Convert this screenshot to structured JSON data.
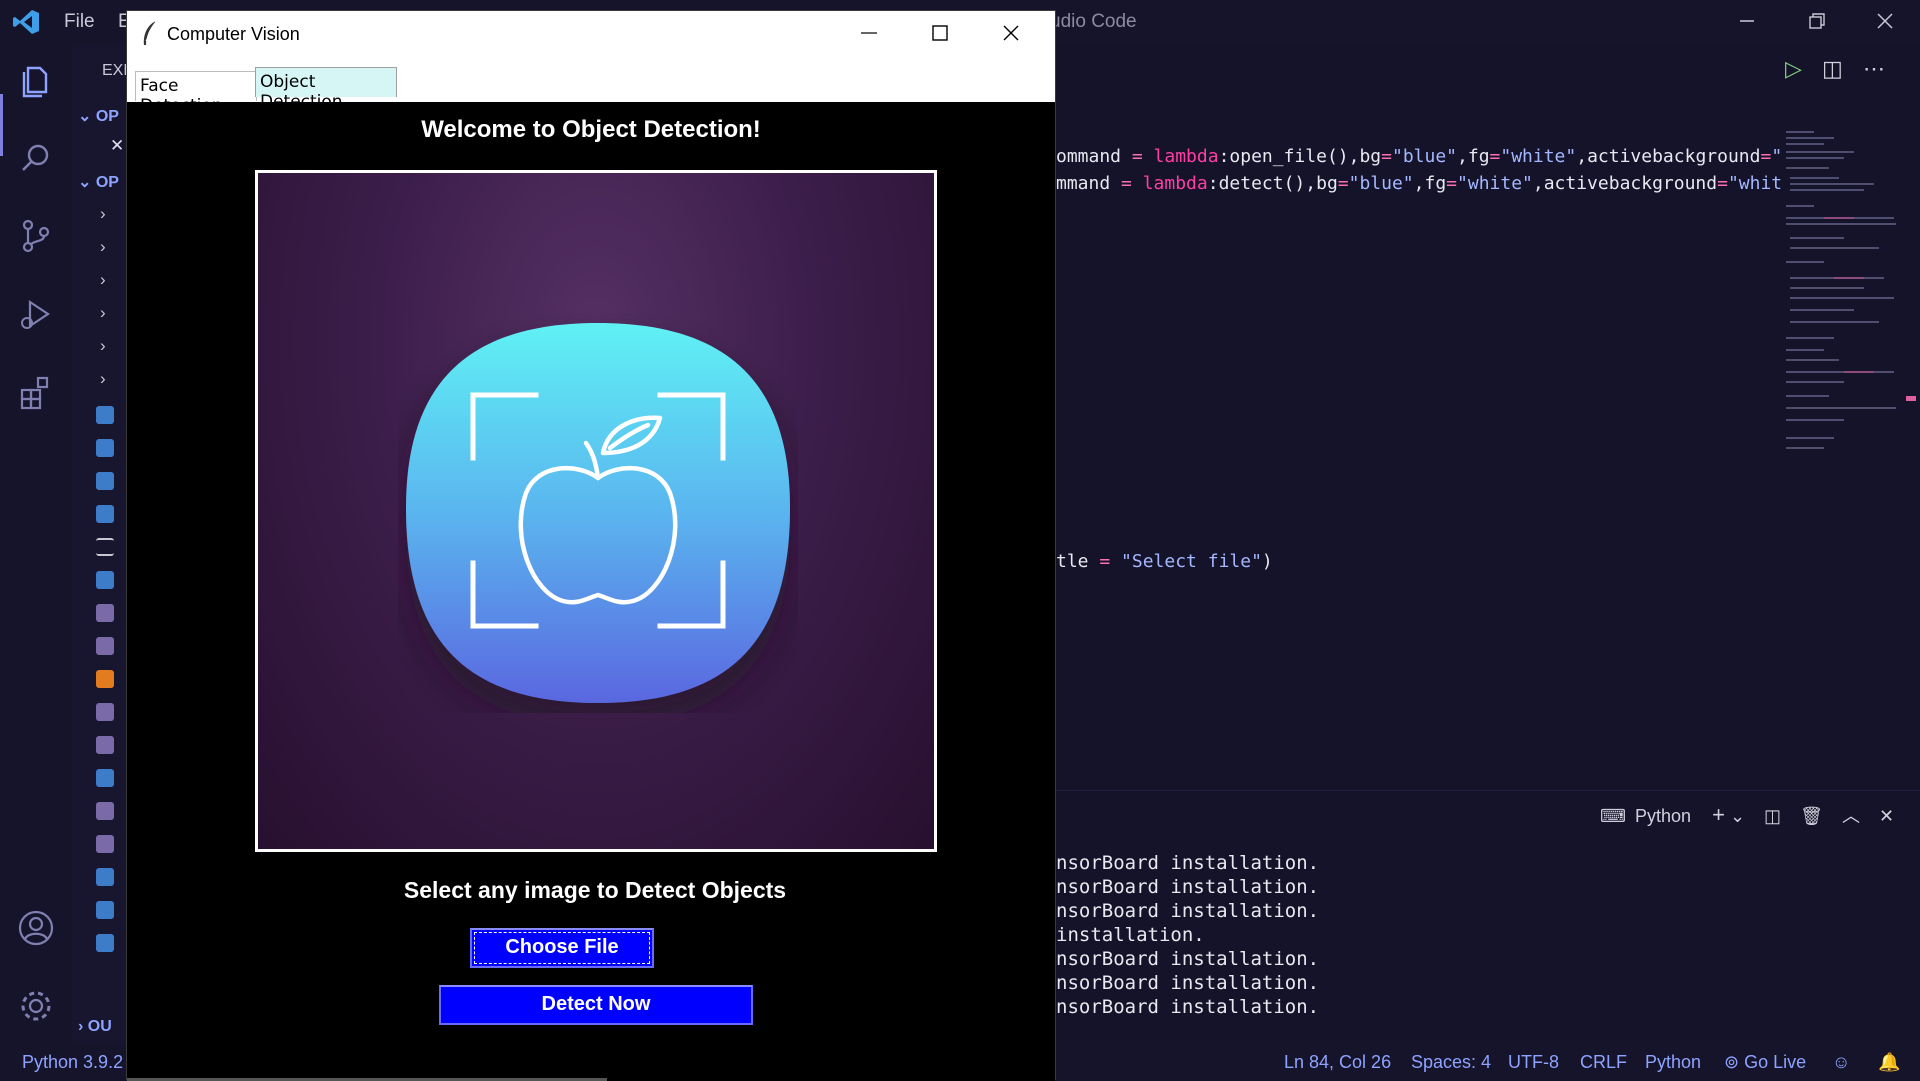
{
  "vscode": {
    "menu": {
      "file": "File",
      "edit": "E"
    },
    "title_fragment": "udio Code",
    "sidebar": {
      "explorer_label": "EXP",
      "open_editors_section": "OP",
      "open_folder_section": "OP",
      "outline_section": "OU",
      "close_glyph": "✕"
    },
    "code_lines": [
      {
        "a": "ommand",
        "b": " = ",
        "c": "lambda",
        "d": ":open_file(),bg",
        "e": "=",
        "f": "\"blue\"",
        "g": ",fg",
        "h": "=",
        "i": "\"white\"",
        "j": ",activebackground",
        "k": "=",
        "l": "\""
      },
      {
        "a": "mmand",
        "b": " = ",
        "c": "lambda",
        "d": ":detect(),bg",
        "e": "=",
        "f": "\"blue\"",
        "g": ",fg",
        "h": "=",
        "i": "\"white\"",
        "j": ",activebackground",
        "k": "=",
        "l": "\"whit"
      }
    ],
    "code_title_line": {
      "a": "tle",
      "b": " = ",
      "c": "\"Select file\"",
      "d": ")"
    },
    "terminal": {
      "profile": "Python",
      "lines": [
        "nsorBoard installation.",
        "nsorBoard installation.",
        "nsorBoard installation.",
        "installation.",
        "nsorBoard installation.",
        "nsorBoard installation.",
        "nsorBoard installation."
      ]
    },
    "statusbar": {
      "python_version": "Python 3.9.2",
      "cursor": "Ln 84, Col 26",
      "spaces": "Spaces: 4",
      "encoding": "UTF-8",
      "eol": "CRLF",
      "language": "Python",
      "go_live": "Go Live"
    }
  },
  "tk_app": {
    "window_title": "Computer Vision",
    "tabs": [
      {
        "label": "Face Detection",
        "selected": false
      },
      {
        "label": "Object Detection",
        "selected": true
      }
    ],
    "heading": "Welcome to Object Detection!",
    "prompt": "Select any image to Detect Objects",
    "choose_button": "Choose File",
    "detect_button": "Detect Now",
    "colors": {
      "button_bg": "#0000ff",
      "button_fg": "#ffffff",
      "body_bg": "#000000",
      "tab_selected_bg": "#d6f6f6"
    },
    "image_icon": "apple-in-viewfinder-icon"
  }
}
